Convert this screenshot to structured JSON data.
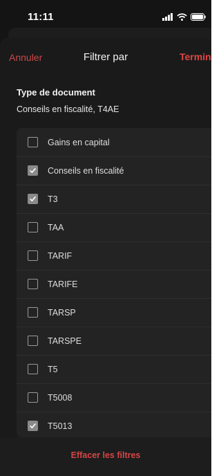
{
  "status_bar": {
    "time": "11:11",
    "icons": [
      "signal-icon",
      "wifi-icon",
      "battery-icon"
    ]
  },
  "nav": {
    "cancel_label": "Annuler",
    "title": "Filtrer par",
    "done_label": "Terminé"
  },
  "section": {
    "title": "Type de document",
    "summary": "Conseils en fiscalité, T4AE"
  },
  "options": [
    {
      "label": "Gains en capital",
      "checked": false
    },
    {
      "label": "Conseils en fiscalité",
      "checked": true
    },
    {
      "label": "T3",
      "checked": true
    },
    {
      "label": "TAA",
      "checked": false
    },
    {
      "label": "TARIF",
      "checked": false
    },
    {
      "label": "TARIFE",
      "checked": false
    },
    {
      "label": "TARSP",
      "checked": false
    },
    {
      "label": "TARSPE",
      "checked": false
    },
    {
      "label": "T5",
      "checked": false
    },
    {
      "label": "T5008",
      "checked": false
    },
    {
      "label": "T5013",
      "checked": true
    }
  ],
  "footer": {
    "clear_label": "Effacer les filtres"
  },
  "colors": {
    "accent": "#e04646",
    "background": "#1a1a1a",
    "list_background": "#232323"
  }
}
